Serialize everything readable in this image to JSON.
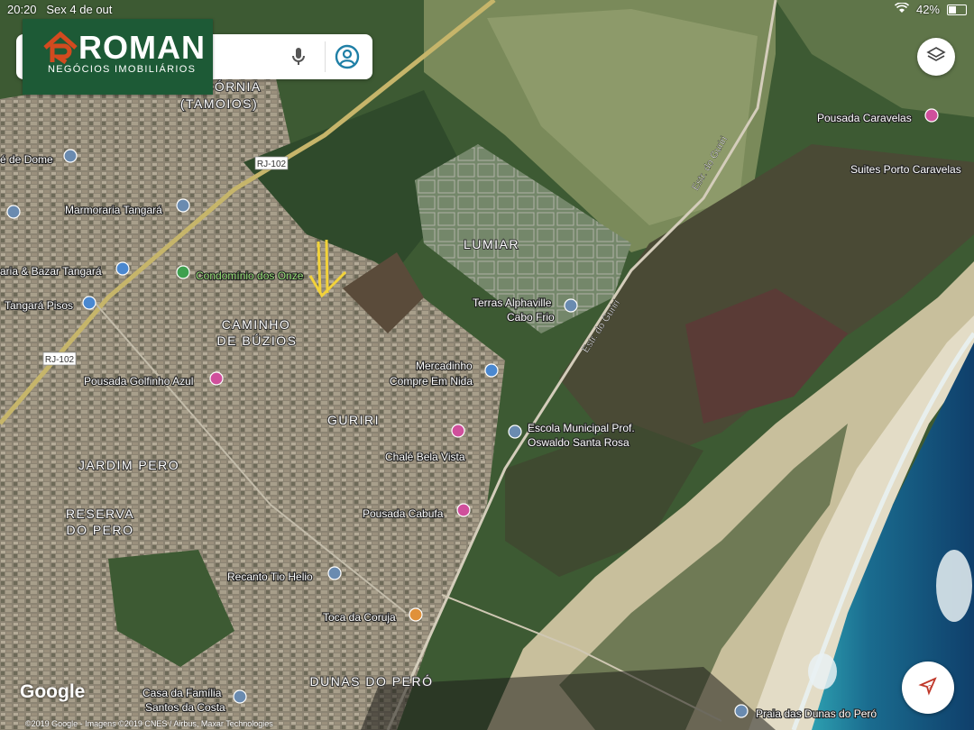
{
  "status_bar": {
    "time": "20:20",
    "date": "Sex 4 de out",
    "battery": "42%"
  },
  "logo": {
    "brand": "ROMAN",
    "tagline": "NEGÓCIOS IMOBILIÁRIOS",
    "colors": {
      "background": "#1d5a36",
      "accent": "#d24a1f"
    }
  },
  "search_bar": {
    "mic_icon": "mic-icon",
    "account_icon": "account-circle-icon"
  },
  "buttons": {
    "layers_icon": "layers-icon",
    "navigate_icon": "navigation-arrow-icon"
  },
  "map": {
    "attribution_logo": "Google",
    "copyright": "©2019 Google - Imagens ©2019 CNES / Airbus, Maxar Technologies",
    "neighborhoods": [
      {
        "name": "CÓRNIA",
        "id": "cornia"
      },
      {
        "name": "(TAMOIOS)",
        "id": "tamoios"
      },
      {
        "name": "LUMIAR",
        "id": "lumiar"
      },
      {
        "name": "CAMINHO",
        "id": "caminho"
      },
      {
        "name": "DE BÚZIOS",
        "id": "de-buzios"
      },
      {
        "name": "GURIRI",
        "id": "guriri"
      },
      {
        "name": "JARDIM PERO",
        "id": "jardim-pero"
      },
      {
        "name": "RESERVA",
        "id": "reserva"
      },
      {
        "name": "DO PERO",
        "id": "do-pero"
      },
      {
        "name": "DUNAS DO PERÓ",
        "id": "dunas-do-pero"
      }
    ],
    "roads": [
      {
        "name": "RJ-102",
        "id": "rj102-a"
      },
      {
        "name": "RJ-102",
        "id": "rj102-b"
      },
      {
        "name": "Estr. do Guriri",
        "id": "estr-guriri-a"
      },
      {
        "name": "Estr. do Guriri",
        "id": "estr-guriri-b"
      }
    ],
    "places": [
      {
        "name": "é de Dome",
        "icon": "place",
        "id": "de-dome"
      },
      {
        "name": "Marmoraria Tangará",
        "icon": "place",
        "id": "marmoraria"
      },
      {
        "name": "aria & Bazar Tangará",
        "icon": "shopping",
        "id": "bazar"
      },
      {
        "name": "Tangará Pisos",
        "icon": "shopping",
        "id": "pisos"
      },
      {
        "name": "Condomínio dos Onze",
        "icon": "park",
        "id": "condominio"
      },
      {
        "name": "Pousada Golfinho Azul",
        "icon": "lodging",
        "id": "golfinho"
      },
      {
        "name": "Terras Alphaville",
        "icon": "place",
        "id": "alphaville-1"
      },
      {
        "name": "Cabo Frio",
        "icon": "",
        "id": "alphaville-2"
      },
      {
        "name": "Mercadinho",
        "icon": "",
        "id": "mercadinho-1"
      },
      {
        "name": "Compre Em Nida",
        "icon": "shopping",
        "id": "mercadinho-2"
      },
      {
        "name": "Escola Municipal Prof.",
        "icon": "school",
        "id": "escola-1"
      },
      {
        "name": "Oswaldo Santa Rosa",
        "icon": "",
        "id": "escola-2"
      },
      {
        "name": "Chalé Bela Vista",
        "icon": "lodging",
        "id": "chale"
      },
      {
        "name": "Pousada Cabufa",
        "icon": "lodging",
        "id": "cabufa"
      },
      {
        "name": "Recanto Tio Helio",
        "icon": "place",
        "id": "recanto"
      },
      {
        "name": "Toca da Coruja",
        "icon": "food",
        "id": "toca"
      },
      {
        "name": "Casa da Família",
        "icon": "",
        "id": "casa-1"
      },
      {
        "name": "Santos da Costa",
        "icon": "place",
        "id": "casa-2"
      },
      {
        "name": "Pousada Caravelas",
        "icon": "lodging",
        "id": "caravelas"
      },
      {
        "name": "Suites Porto Caravelas",
        "icon": "",
        "id": "suites"
      },
      {
        "name": "Praia das Dunas do Peró",
        "icon": "place",
        "id": "praia"
      }
    ]
  }
}
